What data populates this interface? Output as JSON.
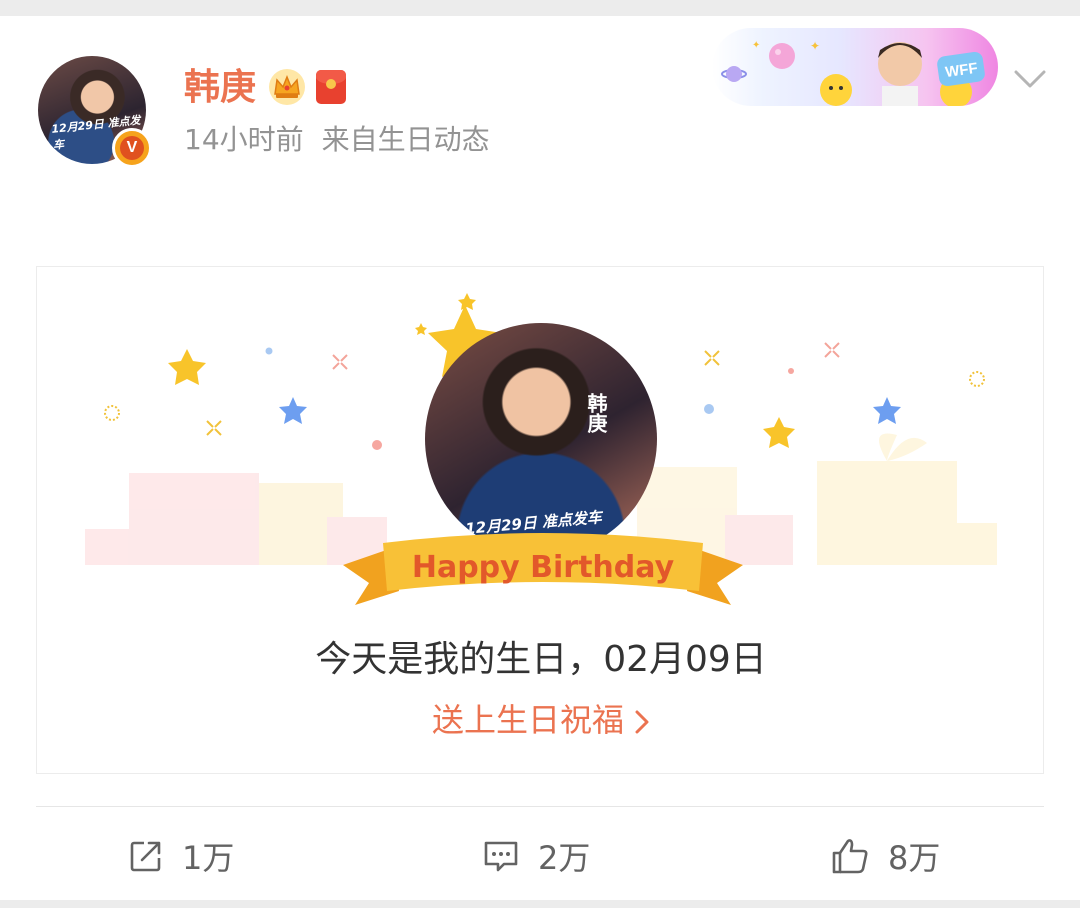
{
  "header": {
    "username": "韩庚",
    "time": "14小时前",
    "source": "来自生日动态",
    "verified_badge": "V",
    "icons": [
      "crown-icon",
      "red-packet-icon",
      "chevron-down-icon"
    ]
  },
  "card_banner": {
    "text": "WFF"
  },
  "birthday_card": {
    "avatar_caption": "12月29日 准点发车",
    "avatar_vertical_text": "韩庚",
    "ribbon_text": "Happy Birthday",
    "message": "今天是我的生日，02月09日",
    "link_label": "送上生日祝福"
  },
  "actions": {
    "share_count": "1万",
    "comment_count": "2万",
    "like_count": "8万"
  },
  "colors": {
    "accent": "#eb7350",
    "ribbon": "#f7b52b",
    "star": "#f8c42a",
    "text_secondary": "#939393"
  }
}
